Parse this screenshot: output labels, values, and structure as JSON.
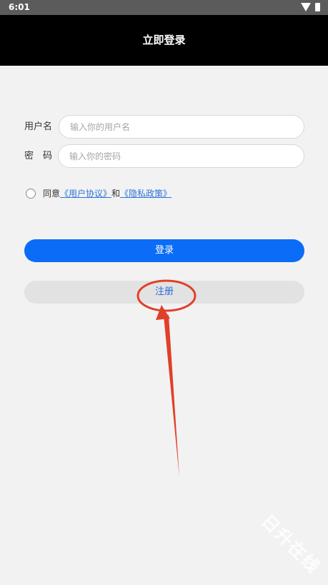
{
  "status_bar": {
    "time": "6:01",
    "icons": [
      "wifi-icon",
      "battery-icon"
    ]
  },
  "header": {
    "title": "立即登录"
  },
  "form": {
    "username_label": "用户名",
    "username_placeholder": "输入你的用户名",
    "username_value": "",
    "password_label": "密　码",
    "password_placeholder": "输入你的密码",
    "password_value": ""
  },
  "agreement": {
    "prefix": "同意",
    "user_agreement": "《用户协议》",
    "conjunction": "和",
    "privacy_policy": "《隐私政策》",
    "checked": false
  },
  "buttons": {
    "login": "登录",
    "register": "注册"
  },
  "colors": {
    "header_bg": "#000000",
    "primary": "#0a6cf7",
    "link": "#2f74d8",
    "annotation": "#e0402a"
  }
}
